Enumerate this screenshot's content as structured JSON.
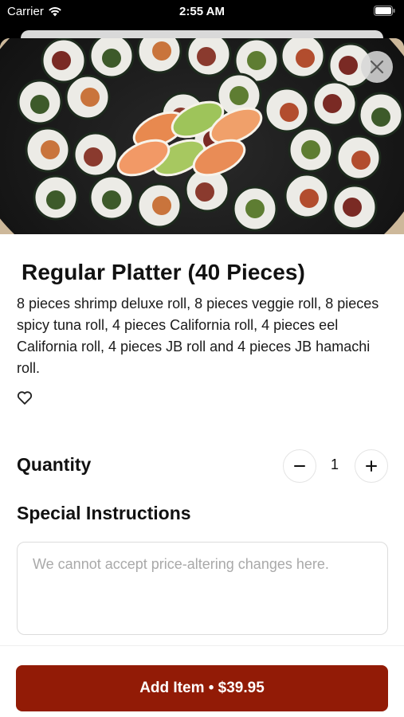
{
  "status_bar": {
    "carrier": "Carrier",
    "time": "2:55 AM",
    "wifi_icon": "wifi-icon",
    "battery_icon": "battery-icon"
  },
  "item": {
    "image_alt": "sushi-platter-photo",
    "close_icon": "close-icon",
    "title": "Regular Platter (40 Pieces)",
    "description": "8 pieces shrimp deluxe roll, 8 pieces veggie roll, 8 pieces spicy tuna roll, 4 pieces California roll, 4 pieces eel California roll, 4 pieces JB roll and 4 pieces JB hamachi roll.",
    "favorite_icon": "heart-outline-icon"
  },
  "quantity": {
    "label": "Quantity",
    "value": "1",
    "decrement_icon": "minus-icon",
    "increment_icon": "plus-icon"
  },
  "special_instructions": {
    "label": "Special Instructions",
    "placeholder": "We cannot accept price-altering changes here.",
    "value": ""
  },
  "footer": {
    "add_button_label": "Add Item • $39.95"
  },
  "colors": {
    "accent": "#921b06",
    "text": "#111111",
    "placeholder": "#a9a9a9"
  }
}
